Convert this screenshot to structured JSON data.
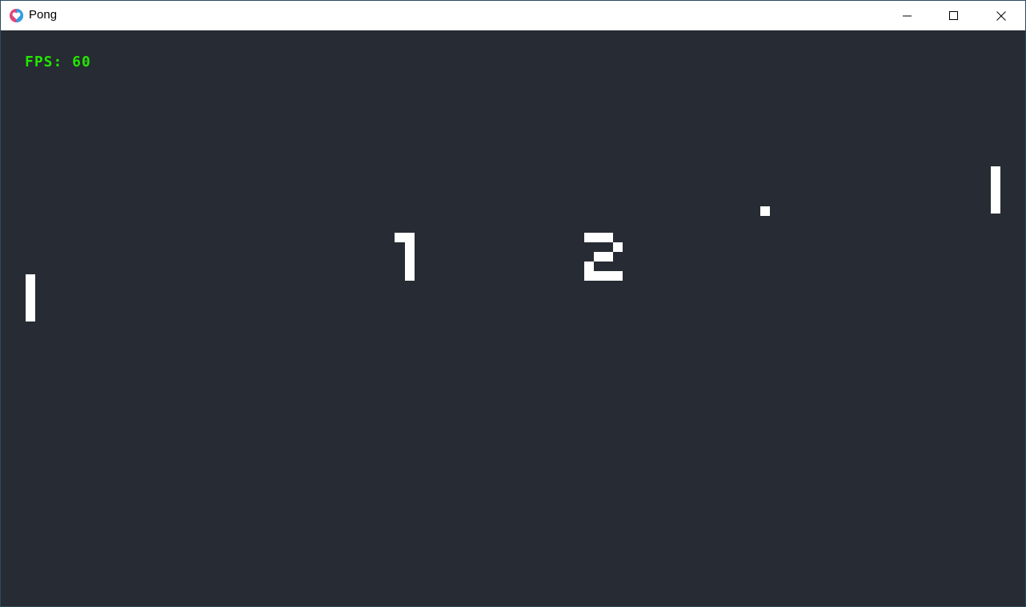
{
  "window": {
    "title": "Pong"
  },
  "window_controls": {
    "minimize_icon": "minimize-icon",
    "maximize_icon": "maximize-icon",
    "close_icon": "close-icon"
  },
  "hud": {
    "fps": "FPS: 60",
    "fps_color": "#22e600"
  },
  "scores": {
    "left": "1",
    "right": "2"
  },
  "colors": {
    "background": "#272b33",
    "foreground": "#ffffff"
  }
}
